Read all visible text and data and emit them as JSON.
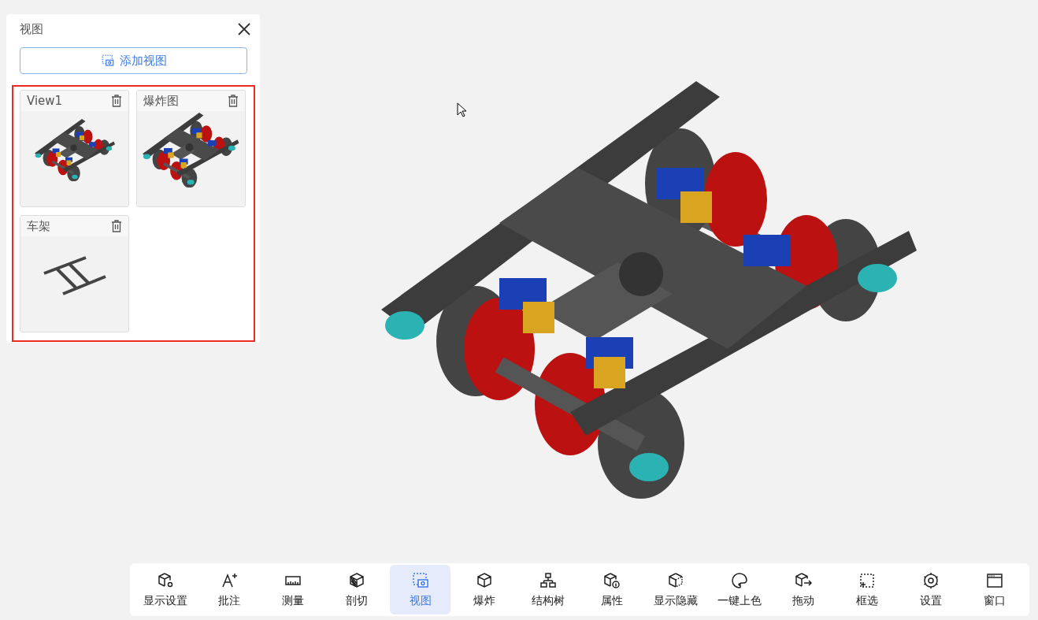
{
  "panel": {
    "title": "视图",
    "add_button": "添加视图",
    "views": [
      {
        "title": "View1"
      },
      {
        "title": "爆炸图"
      },
      {
        "title": "车架"
      }
    ]
  },
  "toolbar": [
    {
      "label": "显示设置",
      "selected": false
    },
    {
      "label": "批注",
      "selected": false
    },
    {
      "label": "测量",
      "selected": false
    },
    {
      "label": "剖切",
      "selected": false
    },
    {
      "label": "视图",
      "selected": true
    },
    {
      "label": "爆炸",
      "selected": false
    },
    {
      "label": "结构树",
      "selected": false
    },
    {
      "label": "属性",
      "selected": false
    },
    {
      "label": "显示隐藏",
      "selected": false
    },
    {
      "label": "一键上色",
      "selected": false
    },
    {
      "label": "拖动",
      "selected": false
    },
    {
      "label": "框选",
      "selected": false
    },
    {
      "label": "设置",
      "selected": false
    },
    {
      "label": "窗口",
      "selected": false
    }
  ]
}
